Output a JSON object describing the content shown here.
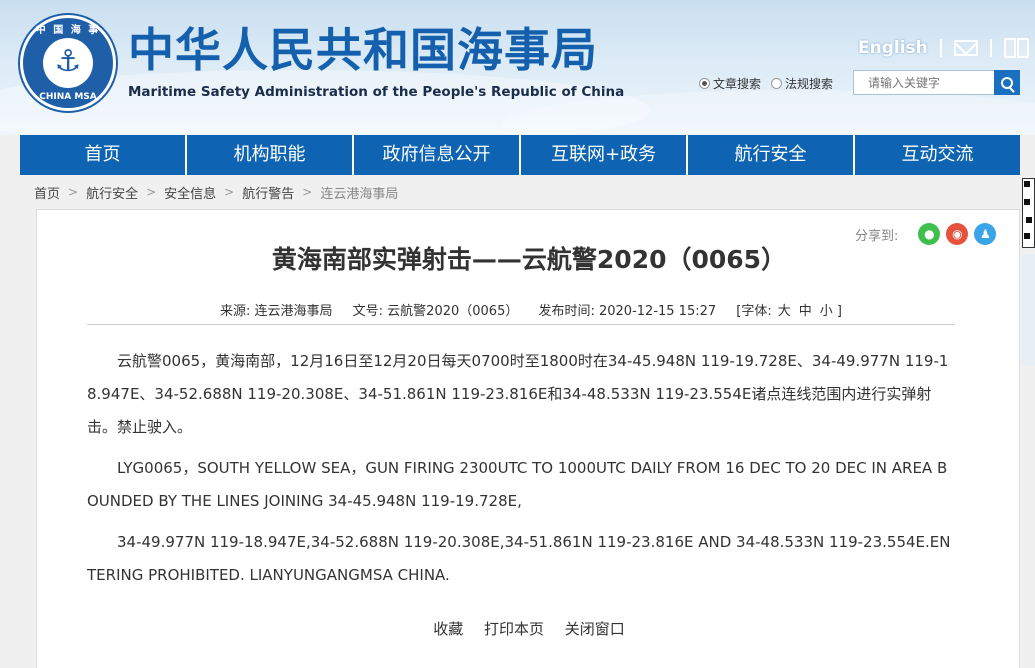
{
  "header": {
    "logo_text_top": "中 国 海 事",
    "logo_text_bottom": "CHINA MSA",
    "logo_icon": "anchor-icon",
    "title_cn": "中华人民共和国海事局",
    "title_en": "Maritime Safety Administration of the People's Republic of China",
    "english_link": "English",
    "mail_icon": "mail-icon",
    "book_icon": "book-icon",
    "search": {
      "options": [
        {
          "label": "文章搜索",
          "selected": true
        },
        {
          "label": "法规搜索",
          "selected": false
        }
      ],
      "placeholder": "请输入关键字"
    }
  },
  "nav": {
    "items": [
      "首页",
      "机构职能",
      "政府信息公开",
      "互联网+政务",
      "航行安全",
      "互动交流"
    ]
  },
  "breadcrumb": {
    "items": [
      "首页",
      "航行安全",
      "安全信息",
      "航行警告"
    ],
    "current": "连云港海事局"
  },
  "share": {
    "label": "分享到:",
    "icons": [
      "wechat-icon",
      "weibo-icon",
      "qq-icon"
    ]
  },
  "article": {
    "title": "黄海南部实弹射击——云航警2020（0065）",
    "source_label": "来源: 连云港海事局",
    "doc_no_label": "文号: 云航警2020（0065）",
    "published_label": "发布时间: 2020-12-15 15:27",
    "font_size_label": "[字体:",
    "font_large": "大",
    "font_medium": "中",
    "font_small": "小 ]",
    "paragraphs": [
      "云航警0065，黄海南部，12月16日至12月20日每天0700时至1800时在34-45.948N 119-19.728E、34-49.977N 119-18.947E、34-52.688N 119-20.308E、34-51.861N 119-23.816E和34-48.533N 119-23.554E诸点连线范围内进行实弹射击。禁止驶入。",
      "LYG0065，SOUTH YELLOW SEA，GUN FIRING 2300UTC TO 1000UTC DAILY FROM 16 DEC TO 20 DEC IN AREA BOUNDED BY THE LINES JOINING 34-45.948N 119-19.728E,",
      "34-49.977N 119-18.947E,34-52.688N 119-20.308E,34-51.861N 119-23.816E AND 34-48.533N 119-23.554E.ENTERING PROHIBITED. LIANYUNGANGMSA CHINA."
    ],
    "actions": [
      "收藏",
      "打印本页",
      "关闭窗口"
    ]
  }
}
